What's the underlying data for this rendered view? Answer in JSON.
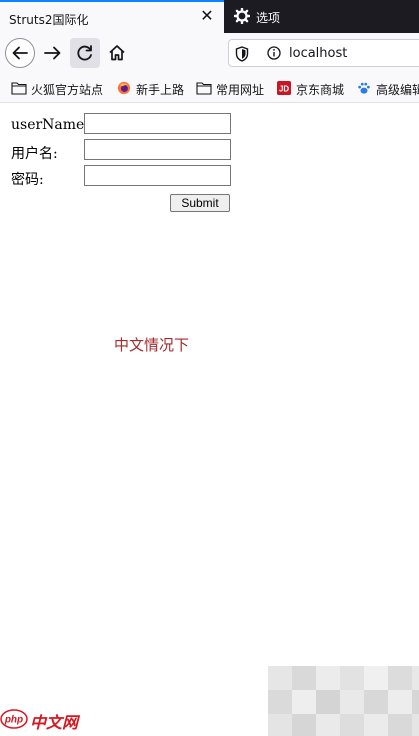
{
  "tabs": [
    {
      "title": "Struts2国际化",
      "active": true
    },
    {
      "title": "选项",
      "active": false,
      "icon": "gear-icon"
    }
  ],
  "navbar": {
    "url": "localhost"
  },
  "bookmarks": [
    {
      "label": "火狐官方站点",
      "icon": "folder-icon"
    },
    {
      "label": "新手上路",
      "icon": "firefox-icon"
    },
    {
      "label": "常用网址",
      "icon": "folder-icon"
    },
    {
      "label": "京东商城",
      "icon": "jd-icon"
    },
    {
      "label": "高级编辑",
      "icon": "paw-icon"
    }
  ],
  "form": {
    "username_label": "userName:",
    "username_value": "",
    "name_label": "用户名:",
    "name_value": "",
    "password_label": "密码:",
    "password_value": "",
    "submit_label": "Submit"
  },
  "status_text": "中文情况下",
  "watermark": {
    "text": "中文网"
  },
  "colors": {
    "tab_accent": "#0a84ff",
    "tab_strip": "#1c1b22",
    "status_text": "#a52a2a",
    "watermark": "#d7171f"
  }
}
